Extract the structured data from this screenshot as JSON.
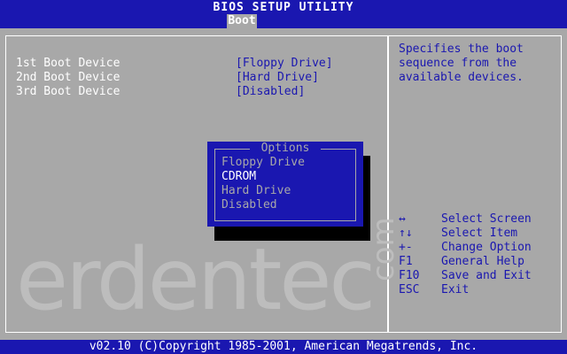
{
  "header": {
    "title": "BIOS SETUP UTILITY",
    "active_tab": "Boot"
  },
  "settings": [
    {
      "label": "1st Boot Device",
      "value": "[Floppy Drive]"
    },
    {
      "label": "2nd Boot Device",
      "value": "[Hard Drive]"
    },
    {
      "label": "3rd Boot Device",
      "value": "[Disabled]"
    }
  ],
  "help": {
    "description": "Specifies the boot\nsequence from the\navailable devices.",
    "keys": [
      {
        "key": "↔",
        "action": "Select Screen"
      },
      {
        "key": "↑↓",
        "action": "Select Item"
      },
      {
        "key": "+-",
        "action": "Change Option"
      },
      {
        "key": "F1",
        "action": "General Help"
      },
      {
        "key": "F10",
        "action": "Save and Exit"
      },
      {
        "key": "ESC",
        "action": "Exit"
      }
    ]
  },
  "popup": {
    "title": "Options",
    "options": [
      "Floppy Drive",
      "CDROM",
      "Hard Drive",
      "Disabled"
    ],
    "selected": "CDROM"
  },
  "watermark": {
    "text": "erdentec",
    "suffix": "com"
  },
  "footer": {
    "text": "v02.10 (C)Copyright 1985-2001, American Megatrends, Inc."
  },
  "colors": {
    "background": "#a8a8a8",
    "bar": "#1a17b0",
    "highlight": "#ffffff",
    "shadow": "#000000"
  }
}
